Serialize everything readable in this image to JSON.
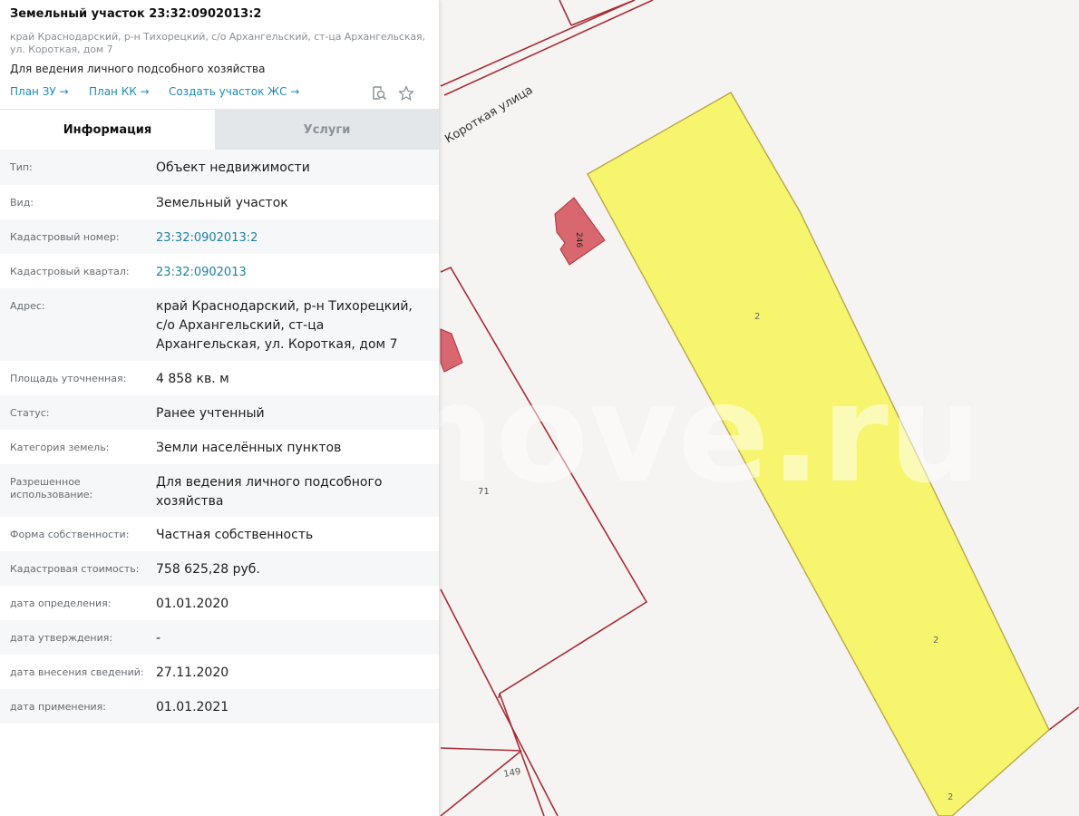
{
  "header": {
    "title": "Земельный участок 23:32:0902013:2",
    "address": "край Краснодарский, р-н Тихорецкий, с/о Архангельский, ст-ца Архангельская,\nул. Короткая, дом 7",
    "purpose": "Для ведения личного подсобного хозяйства",
    "links": [
      "План ЗУ →",
      "План КК →",
      "Создать участок ЖС →"
    ],
    "icons": [
      "search-document-icon",
      "star-icon"
    ]
  },
  "tabs": [
    {
      "label": "Информация",
      "active": true
    },
    {
      "label": "Услуги",
      "active": false
    }
  ],
  "info": [
    {
      "key": "Тип:",
      "value": "Объект недвижимости"
    },
    {
      "key": "Вид:",
      "value": "Земельный участок"
    },
    {
      "key": "Кадастровый номер:",
      "value": "23:32:0902013:2",
      "link": true
    },
    {
      "key": "Кадастровый квартал:",
      "value": "23:32:0902013",
      "link": true
    },
    {
      "key": "Адрес:",
      "value": "край Краснодарский, р-н Тихорецкий, с/о Архангельский, ст-ца Архангельская, ул. Короткая, дом 7"
    },
    {
      "key": "Площадь уточненная:",
      "value": "4 858 кв. м"
    },
    {
      "key": "Статус:",
      "value": "Ранее учтенный"
    },
    {
      "key": "Категория земель:",
      "value": "Земли населённых пунктов"
    },
    {
      "key": "Разрешенное использование:",
      "value": "Для ведения личного подсобного хозяйства"
    },
    {
      "key": "Форма собственности:",
      "value": "Частная собственность"
    },
    {
      "key": "Кадастровая стоимость:",
      "value": "758 625,28 руб."
    },
    {
      "key": "дата определения:",
      "value": "01.01.2020"
    },
    {
      "key": "дата утверждения:",
      "value": "-"
    },
    {
      "key": "дата внесения сведений:",
      "value": "27.11.2020"
    },
    {
      "key": "дата применения:",
      "value": "01.01.2021"
    }
  ],
  "map": {
    "street_label": "Короткая улица",
    "parcel_labels": [
      "2",
      "2",
      "2",
      "71",
      "149",
      "246"
    ],
    "watermark": "move.ru",
    "colors": {
      "background": "#f5f4f2",
      "parcel_fill": "#f7f56e",
      "parcel_stroke": "#b8a84a",
      "boundary": "#b0303c",
      "building": "#d9676f"
    }
  }
}
